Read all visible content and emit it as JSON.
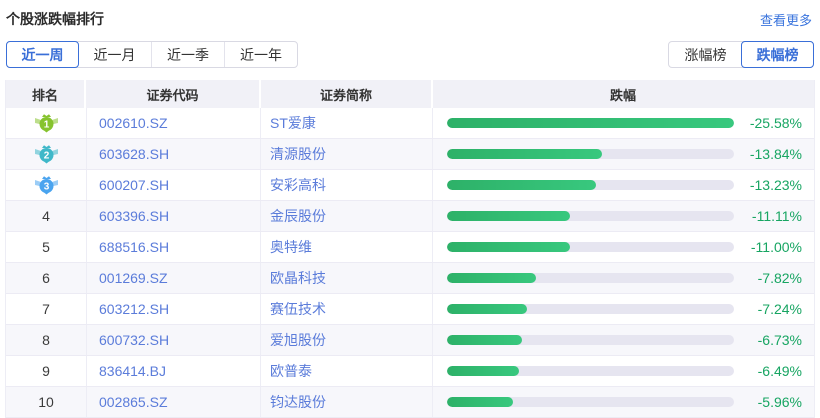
{
  "header": {
    "title": "个股涨跌幅排行",
    "more_label": "查看更多"
  },
  "period_tabs": {
    "items": [
      "近一周",
      "近一月",
      "近一季",
      "近一年"
    ],
    "active_index": 0
  },
  "rank_tabs": {
    "items": [
      "涨幅榜",
      "跌幅榜"
    ],
    "active_index": 1
  },
  "table": {
    "columns": [
      "排名",
      "证券代码",
      "证券简称",
      "跌幅"
    ],
    "max_value": 25.58,
    "rows": [
      {
        "rank": 1,
        "code": "002610.SZ",
        "name": "ST爱康",
        "pct": "-25.58%",
        "value": 25.58
      },
      {
        "rank": 2,
        "code": "603628.SH",
        "name": "清源股份",
        "pct": "-13.84%",
        "value": 13.84
      },
      {
        "rank": 3,
        "code": "600207.SH",
        "name": "安彩高科",
        "pct": "-13.23%",
        "value": 13.23
      },
      {
        "rank": 4,
        "code": "603396.SH",
        "name": "金辰股份",
        "pct": "-11.11%",
        "value": 11.11
      },
      {
        "rank": 5,
        "code": "688516.SH",
        "name": "奥特维",
        "pct": "-11.00%",
        "value": 11.0
      },
      {
        "rank": 6,
        "code": "001269.SZ",
        "name": "欧晶科技",
        "pct": "-7.82%",
        "value": 7.82
      },
      {
        "rank": 7,
        "code": "603212.SH",
        "name": "赛伍技术",
        "pct": "-7.24%",
        "value": 7.24
      },
      {
        "rank": 8,
        "code": "600732.SH",
        "name": "爱旭股份",
        "pct": "-6.73%",
        "value": 6.73
      },
      {
        "rank": 9,
        "code": "836414.BJ",
        "name": "欧普泰",
        "pct": "-6.49%",
        "value": 6.49
      },
      {
        "rank": 10,
        "code": "002865.SZ",
        "name": "钧达股份",
        "pct": "-5.96%",
        "value": 5.96
      }
    ]
  },
  "colors": {
    "accent_blue": "#3a6fd8",
    "link_blue": "#5b7cda",
    "bar_green": "#31bf73",
    "pct_green": "#17a562",
    "medal_colors": [
      "#86c32e",
      "#3fb8c9",
      "#4aa4ef"
    ]
  }
}
